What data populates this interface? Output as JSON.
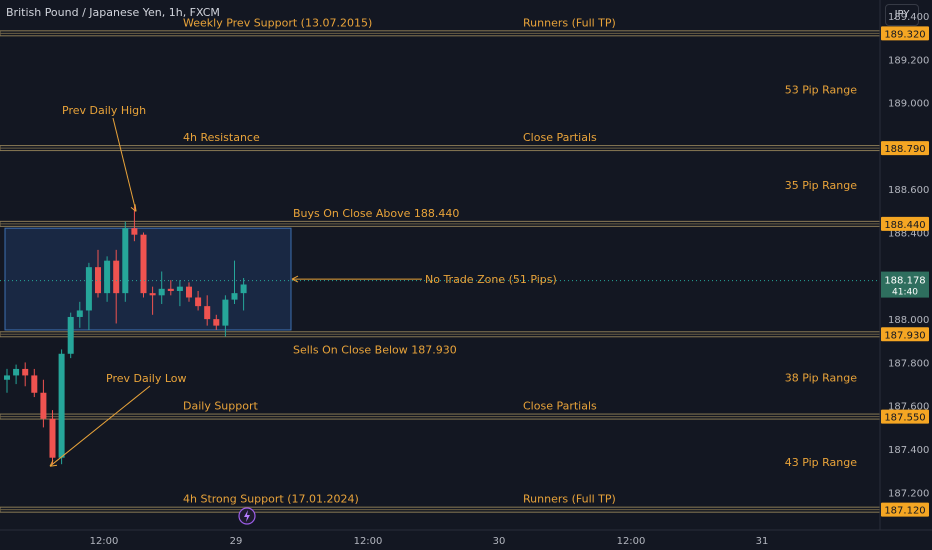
{
  "header": {
    "symbol": "British Pound / Japanese Yen, 1h, FXCM",
    "currency_button": "JPY"
  },
  "colors": {
    "background": "#131722",
    "annotation": "#e8a33a",
    "level_line": "#8a7a55",
    "bull": "#26a69a",
    "bear": "#ef5350",
    "axis_text": "#b2b5be",
    "badge_bg": "#f5a623",
    "price_badge": "#2e6e5e",
    "zone_fill": "#1c2f4f",
    "zone_border": "#3d6fb0"
  },
  "chart_data": {
    "type": "candlestick",
    "symbol": "GBPJPY",
    "timeframe": "1h",
    "ylim": [
      187.1,
      189.4
    ],
    "y_ticks": [
      "189.400",
      "189.200",
      "189.000",
      "188.800",
      "188.600",
      "188.400",
      "188.200",
      "188.000",
      "187.800",
      "187.600",
      "187.400",
      "187.200"
    ],
    "x_ticks": [
      "12:00",
      "29",
      "12:00",
      "30",
      "12:00",
      "31"
    ],
    "current_price": "188.178",
    "countdown": "41:40",
    "levels": [
      {
        "price": 189.32,
        "label": "189.320",
        "left_text": "Weekly Prev Support (13.07.2015)",
        "right_text": "Runners (Full TP)"
      },
      {
        "price": 188.79,
        "label": "188.790",
        "left_text": "4h Resistance",
        "right_text": "Close Partials"
      },
      {
        "price": 188.44,
        "label": "188.440",
        "left_text": "Buys On Close Above 188.440",
        "right_text": ""
      },
      {
        "price": 187.93,
        "label": "187.930",
        "left_text": "Sells On Close Below 187.930",
        "right_text": ""
      },
      {
        "price": 187.55,
        "label": "187.550",
        "left_text": "Daily Support",
        "right_text": "Close Partials"
      },
      {
        "price": 187.12,
        "label": "187.120",
        "left_text": "4h Strong Support (17.01.2024)",
        "right_text": "Runners (Full TP)"
      }
    ],
    "ranges": [
      {
        "price": 189.06,
        "label": "53 Pip Range"
      },
      {
        "price": 188.62,
        "label": "35 Pip Range"
      },
      {
        "price": 187.73,
        "label": "38 Pip Range"
      },
      {
        "price": 187.34,
        "label": "43 Pip Range"
      }
    ],
    "zone": {
      "top": 188.42,
      "bottom": 187.95,
      "label": "No Trade Zone (51 Pips)"
    },
    "annotations": [
      {
        "label": "Prev Daily High",
        "price": 188.47
      },
      {
        "label": "Prev Daily Low",
        "price": 187.33
      }
    ],
    "candles": [
      {
        "o": 187.72,
        "h": 187.77,
        "l": 187.66,
        "c": 187.74
      },
      {
        "o": 187.74,
        "h": 187.79,
        "l": 187.7,
        "c": 187.77
      },
      {
        "o": 187.77,
        "h": 187.8,
        "l": 187.69,
        "c": 187.74
      },
      {
        "o": 187.74,
        "h": 187.77,
        "l": 187.64,
        "c": 187.66
      },
      {
        "o": 187.66,
        "h": 187.72,
        "l": 187.5,
        "c": 187.54
      },
      {
        "o": 187.54,
        "h": 187.58,
        "l": 187.33,
        "c": 187.36
      },
      {
        "o": 187.36,
        "h": 187.86,
        "l": 187.33,
        "c": 187.84
      },
      {
        "o": 187.84,
        "h": 188.03,
        "l": 187.82,
        "c": 188.01
      },
      {
        "o": 188.01,
        "h": 188.08,
        "l": 187.96,
        "c": 188.04
      },
      {
        "o": 188.04,
        "h": 188.26,
        "l": 187.95,
        "c": 188.24
      },
      {
        "o": 188.24,
        "h": 188.32,
        "l": 188.1,
        "c": 188.12
      },
      {
        "o": 188.12,
        "h": 188.29,
        "l": 188.08,
        "c": 188.27
      },
      {
        "o": 188.27,
        "h": 188.32,
        "l": 187.98,
        "c": 188.12
      },
      {
        "o": 188.12,
        "h": 188.45,
        "l": 188.08,
        "c": 188.42
      },
      {
        "o": 188.42,
        "h": 188.52,
        "l": 188.36,
        "c": 188.39
      },
      {
        "o": 188.39,
        "h": 188.4,
        "l": 188.1,
        "c": 188.12
      },
      {
        "o": 188.12,
        "h": 188.15,
        "l": 188.02,
        "c": 188.11
      },
      {
        "o": 188.11,
        "h": 188.22,
        "l": 188.07,
        "c": 188.14
      },
      {
        "o": 188.14,
        "h": 188.18,
        "l": 188.11,
        "c": 188.13
      },
      {
        "o": 188.13,
        "h": 188.18,
        "l": 188.06,
        "c": 188.15
      },
      {
        "o": 188.15,
        "h": 188.17,
        "l": 188.08,
        "c": 188.1
      },
      {
        "o": 188.1,
        "h": 188.13,
        "l": 188.04,
        "c": 188.06
      },
      {
        "o": 188.06,
        "h": 188.11,
        "l": 187.97,
        "c": 188.0
      },
      {
        "o": 188.0,
        "h": 188.02,
        "l": 187.95,
        "c": 187.97
      },
      {
        "o": 187.97,
        "h": 188.11,
        "l": 187.92,
        "c": 188.09
      },
      {
        "o": 188.09,
        "h": 188.27,
        "l": 188.07,
        "c": 188.12
      },
      {
        "o": 188.12,
        "h": 188.19,
        "l": 188.04,
        "c": 188.16
      }
    ]
  }
}
